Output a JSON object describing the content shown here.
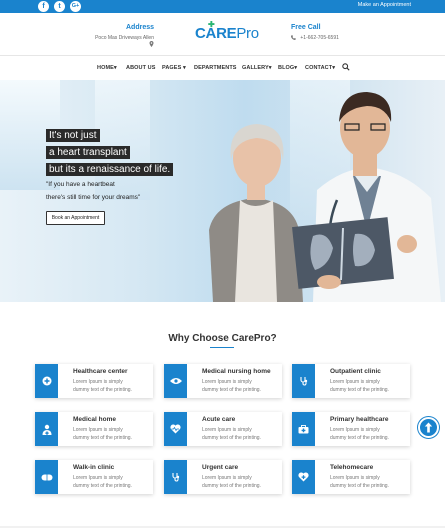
{
  "topbar": {
    "social_icons": [
      "facebook-icon",
      "twitter-icon",
      "google-plus-icon"
    ],
    "social_glyphs": [
      "f",
      "t",
      "G+"
    ],
    "appointment_link": "Make an Appointment"
  },
  "header": {
    "address_title": "Address",
    "address_text": "Poco Mas Driveways Allen",
    "logo_care": "CARE",
    "logo_pro": "Pro",
    "call_title": "Free Call",
    "call_text": "+1-662-705-6591"
  },
  "nav": {
    "items": [
      "HOME",
      "ABOUT US",
      "PAGES",
      "DEPARTMENTS",
      "GALLERY",
      "BLOG",
      "CONTACT"
    ]
  },
  "hero": {
    "lines": [
      "It's not just",
      "a heart transplant",
      "but its a renaissance of life."
    ],
    "quote_1": "\"If you have a heartbeat",
    "quote_2": "there's still time for your dreams\"",
    "button": "Book an Appointment"
  },
  "section": {
    "title": "Why Choose CarePro?"
  },
  "cards": [
    {
      "title": "Healthcare center",
      "icon": "plus-circle-icon",
      "line1": "Lorem Ipsum is simply",
      "line2": "dummy text of the printing."
    },
    {
      "title": "Medical nursing home",
      "icon": "eye-icon",
      "line1": "Lorem Ipsum is simply",
      "line2": "dummy text of the printing."
    },
    {
      "title": "Outpatient clinic",
      "icon": "stethoscope-icon",
      "line1": "Lorem Ipsum is simply",
      "line2": "dummy text of the printing."
    },
    {
      "title": "Medical home",
      "icon": "doctor-icon",
      "line1": "Lorem Ipsum is simply",
      "line2": "dummy text of the printing."
    },
    {
      "title": "Acute care",
      "icon": "heart-pulse-icon",
      "line1": "Lorem Ipsum is simply",
      "line2": "dummy text of the printing."
    },
    {
      "title": "Primary healthcare",
      "icon": "medical-kit-icon",
      "line1": "Lorem Ipsum is simply",
      "line2": "dummy text of the printing."
    },
    {
      "title": "Walk-in clinic",
      "icon": "pill-icon",
      "line1": "Lorem Ipsum is simply",
      "line2": "dummy text of the printing."
    },
    {
      "title": "Urgent care",
      "icon": "stethoscope-icon",
      "line1": "Lorem Ipsum is simply",
      "line2": "dummy text of the printing."
    },
    {
      "title": "Telehomecare",
      "icon": "heart-plus-icon",
      "line1": "Lorem Ipsum is simply",
      "line2": "dummy text of the printing."
    }
  ],
  "colors": {
    "brand": "#1a83cd",
    "accent_green": "#2bb673",
    "hero_text_bg": "#2a2a2a"
  }
}
